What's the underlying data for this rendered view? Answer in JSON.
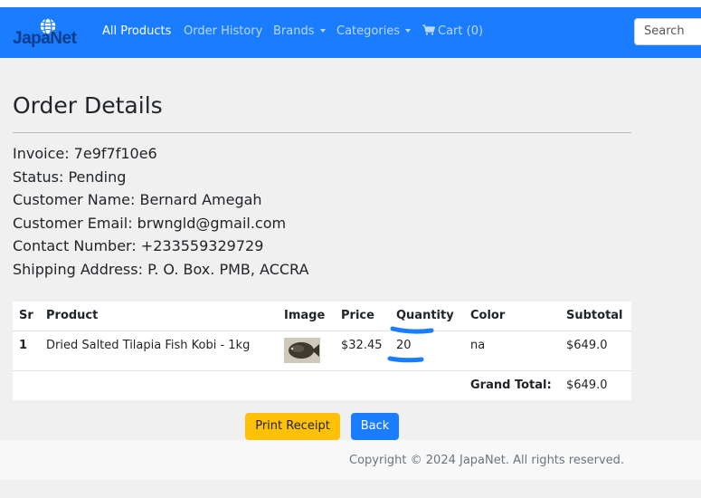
{
  "nav": {
    "brand": "JapaNet",
    "links": [
      "All Products",
      "Order History",
      "Brands",
      "Categories"
    ],
    "cart_label": "Cart (0)",
    "search_placeholder": "Search"
  },
  "page": {
    "title": "Order Details"
  },
  "order": {
    "invoice": "Invoice: 7e9f7f10e6",
    "status": "Status: Pending",
    "customer_name": "Customer Name: Bernard Amegah",
    "customer_email": "Customer Email: brwngld@gmail.com",
    "contact": "Contact Number: +233559329729",
    "address": "Shipping Address: P. O. Box. PMB, ACCRA"
  },
  "table": {
    "headers": [
      "Sr",
      "Product",
      "Image",
      "Price",
      "Quantity",
      "Color",
      "Subtotal"
    ],
    "rows": [
      {
        "sr": "1",
        "product": "Dried Salted Tilapia Fish Kobi - 1kg",
        "price": "$32.45",
        "quantity": "20",
        "color": "na",
        "subtotal": "$649.0"
      }
    ],
    "grand_total_label": "Grand Total:",
    "grand_total_value": "$649.0"
  },
  "buttons": {
    "print": "Print Receipt",
    "back": "Back"
  },
  "footer": {
    "copyright": "Copyright © 2024 JapaNet. All rights reserved."
  },
  "colors": {
    "navbar": "#1a7cff",
    "print_button": "#ffc107",
    "back_button": "#1a7cff",
    "annotation_mark": "#1a7cff"
  }
}
